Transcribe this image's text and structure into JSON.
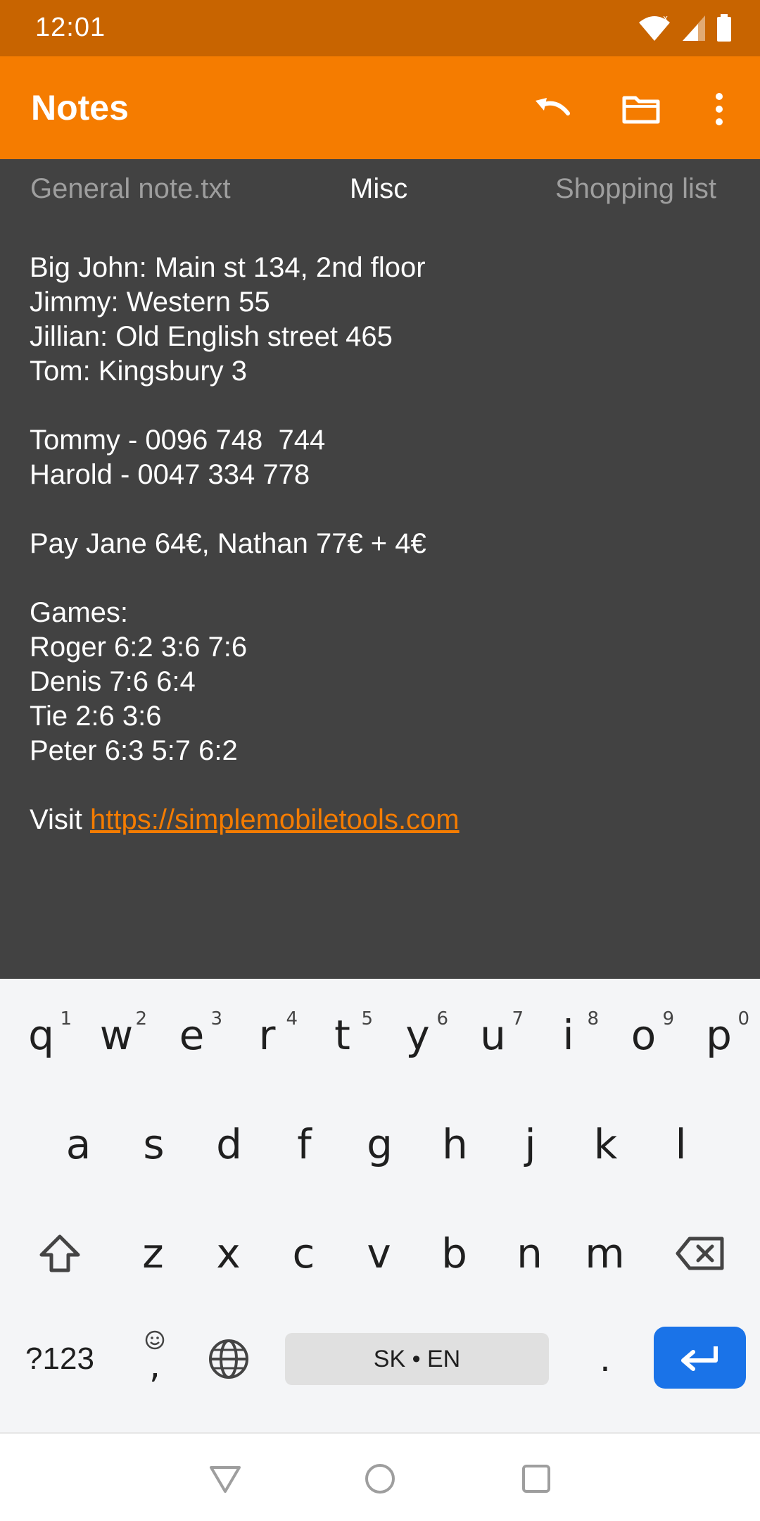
{
  "status_bar": {
    "time": "12:01",
    "icons": [
      "wifi-icon",
      "signal-icon",
      "battery-icon"
    ]
  },
  "app_bar": {
    "title": "Notes",
    "actions": [
      "undo-icon",
      "folder-icon",
      "more-vert-icon"
    ]
  },
  "tabs": [
    {
      "label": "General note.txt",
      "active": false
    },
    {
      "label": "Misc",
      "active": true
    },
    {
      "label": "Shopping list",
      "active": false
    }
  ],
  "note": {
    "lines": [
      "Big John: Main st 134, 2nd floor",
      "Jimmy: Western 55",
      "Jillian: Old English street 465",
      "Tom: Kingsbury 3",
      "",
      "Tommy - 0096 748  744",
      "Harold - 0047 334 778",
      "",
      "Pay Jane 64€, Nathan 77€ + 4€",
      "",
      "Games:",
      "Roger 6:2 3:6 7:6",
      "Denis 7:6 6:4",
      "Tie 2:6 3:6",
      "Peter 6:3 5:7 6:2",
      ""
    ],
    "link_prefix": "Visit ",
    "link_text": "https://simplemobiletools.com"
  },
  "keyboard": {
    "row1": [
      {
        "k": "q",
        "h": "1"
      },
      {
        "k": "w",
        "h": "2"
      },
      {
        "k": "e",
        "h": "3"
      },
      {
        "k": "r",
        "h": "4"
      },
      {
        "k": "t",
        "h": "5"
      },
      {
        "k": "y",
        "h": "6"
      },
      {
        "k": "u",
        "h": "7"
      },
      {
        "k": "i",
        "h": "8"
      },
      {
        "k": "o",
        "h": "9"
      },
      {
        "k": "p",
        "h": "0"
      }
    ],
    "row2": [
      "a",
      "s",
      "d",
      "f",
      "g",
      "h",
      "j",
      "k",
      "l"
    ],
    "row3": [
      "z",
      "x",
      "c",
      "v",
      "b",
      "n",
      "m"
    ],
    "symbols_label": "?123",
    "comma_label": ",",
    "space_label": "SK • EN",
    "period_label": "."
  },
  "colors": {
    "status_bar": "#c86400",
    "app_bar": "#f57c00",
    "accent": "#f57c00",
    "editor_bg": "#424242",
    "enter_key": "#1a73e8"
  }
}
